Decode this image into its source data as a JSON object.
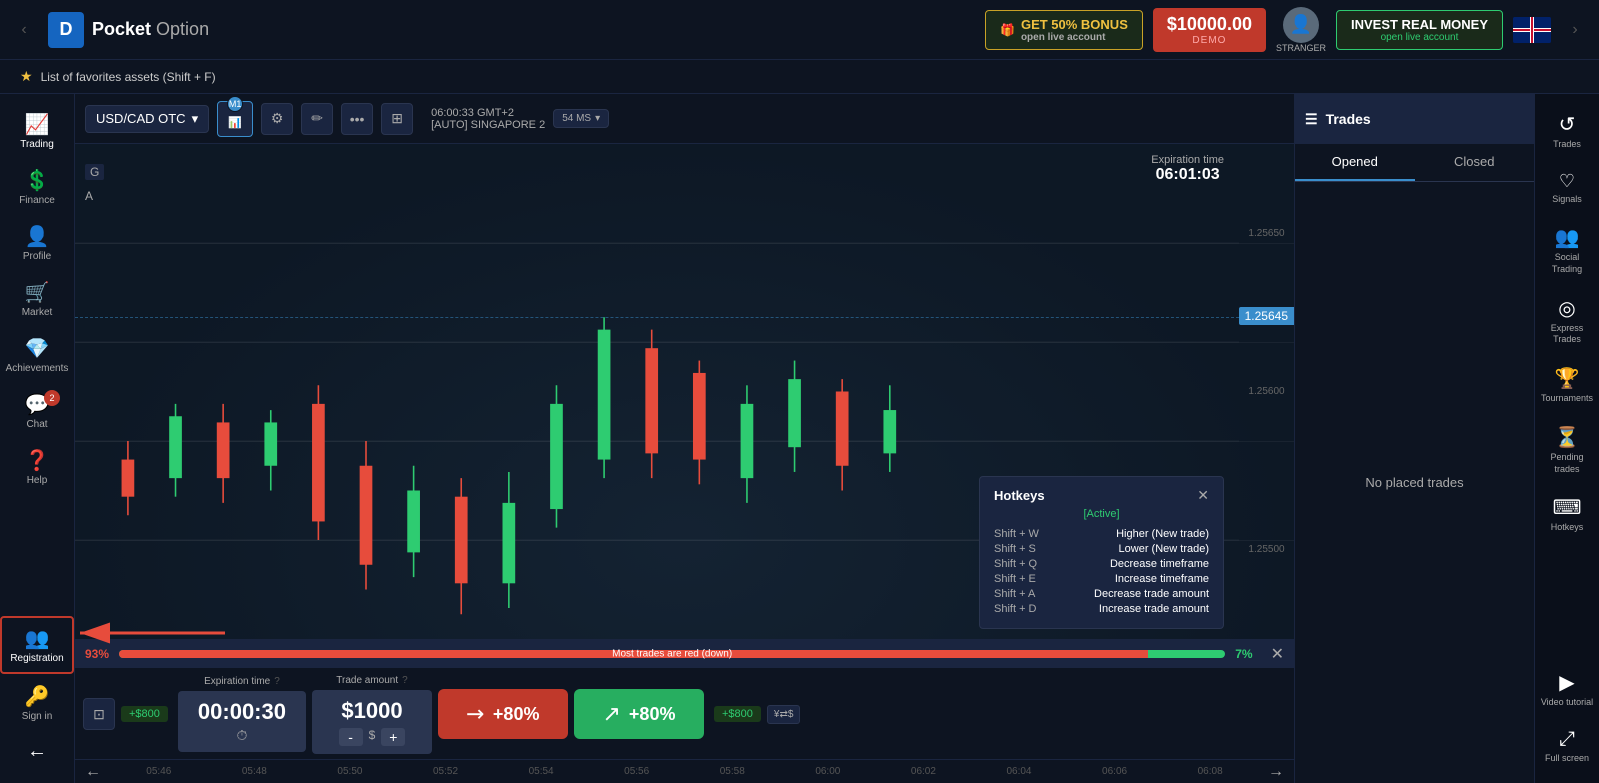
{
  "header": {
    "logo_text": "Pocket",
    "logo_text2": "Option",
    "logo_letter": "D",
    "bonus_label": "GET 50% BONUS",
    "bonus_sub": "open live account",
    "balance": "$10000.00",
    "balance_type": "DEMO",
    "avatar_label": "STRANGER",
    "invest_title": "INVEST REAL MONEY",
    "invest_sub": "open live account",
    "nav_left": "‹",
    "nav_right": "›"
  },
  "fav_bar": {
    "text": "★ List of favorites assets (Shift + F)"
  },
  "sidebar": {
    "items": [
      {
        "label": "Trading",
        "icon": "📈"
      },
      {
        "label": "Finance",
        "icon": "💲"
      },
      {
        "label": "Profile",
        "icon": "👤"
      },
      {
        "label": "Market",
        "icon": "🛒"
      },
      {
        "label": "Achievements",
        "icon": "💎"
      },
      {
        "label": "Chat",
        "icon": "💬",
        "badge": "2"
      },
      {
        "label": "Help",
        "icon": "❓"
      }
    ],
    "registration": {
      "label": "Registration",
      "icon": "👥"
    },
    "signin": {
      "label": "Sign in",
      "icon": "→"
    },
    "arrow_icon": "←"
  },
  "chart": {
    "asset": "USD/CAD OTC",
    "timeframe": "M1",
    "server_time": "06:00:33 GMT+2",
    "server": "[AUTO] SINGAPORE 2",
    "latency": "54 MS",
    "expiration_title": "Expiration time",
    "expiration_time": "06:01:03",
    "price_current": "1.25645",
    "price_high": "1.25650",
    "price_mid": "1.25600",
    "price_low": "1.25500",
    "label_g": "G",
    "label_a": "A",
    "time_ticks": [
      "05:46",
      "05:48",
      "05:50",
      "05:52",
      "05:54",
      "05:56",
      "05:58",
      "06:00",
      "06:02",
      "06:04",
      "06:06",
      "06:08"
    ]
  },
  "hotkeys": {
    "title": "Hotkeys",
    "status": "[Active]",
    "rows": [
      {
        "key": "Shift + W",
        "desc": "Higher (New trade)"
      },
      {
        "key": "Shift + S",
        "desc": "Lower (New trade)"
      },
      {
        "key": "Shift + Q",
        "desc": "Decrease timeframe"
      },
      {
        "key": "Shift + E",
        "desc": "Increase timeframe"
      },
      {
        "key": "Shift + A",
        "desc": "Decrease trade amount"
      },
      {
        "key": "Shift + D",
        "desc": "Increase trade amount"
      }
    ]
  },
  "trades_panel": {
    "title": "Trades",
    "tab_opened": "Opened",
    "tab_closed": "Closed",
    "empty_message": "No placed trades"
  },
  "right_sidebar": {
    "items": [
      {
        "label": "Trades",
        "icon": "↺"
      },
      {
        "label": "Signals",
        "icon": "♡"
      },
      {
        "label": "Social Trading",
        "icon": "👥"
      },
      {
        "label": "Express Trades",
        "icon": "◎"
      },
      {
        "label": "Tournaments",
        "icon": "🏆"
      },
      {
        "label": "Pending trades",
        "icon": "⏳"
      },
      {
        "label": "Hotkeys",
        "icon": "⌨"
      },
      {
        "label": "Video tutorial",
        "icon": "▶"
      },
      {
        "label": "Full screen",
        "icon": "⤢"
      }
    ]
  },
  "trading_controls": {
    "pct_red": "93%",
    "pct_green": "7%",
    "pct_message": "Most trades are red (down)",
    "expiry_label": "Expiration time",
    "expiry_time": "00:00:30",
    "amount_label": "Trade amount",
    "amount_value": "$1000",
    "plus800_left": "+$800",
    "plus800_right": "+$800",
    "sell_pct": "+80%",
    "buy_pct": "+80%"
  }
}
